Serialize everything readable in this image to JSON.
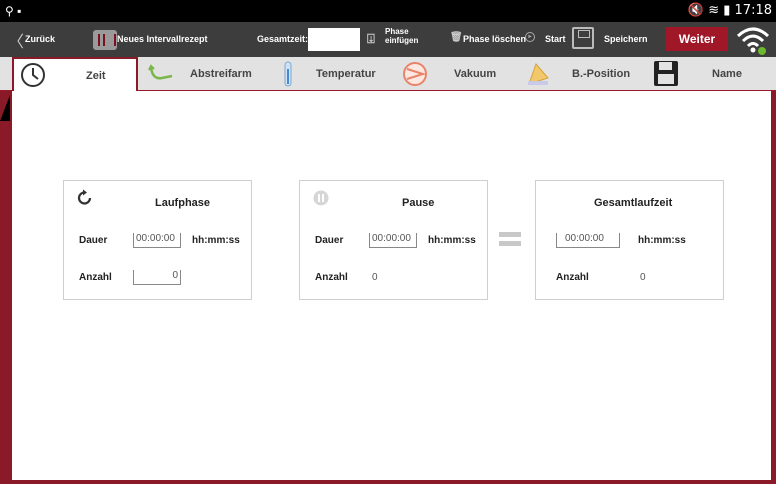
{
  "statusbar": {
    "clock": "17:18",
    "icons_left": "⚲ ▪",
    "icons_right": "🔇 ≋ ▮"
  },
  "actionbar": {
    "back_label": "Zurück",
    "recipe_title": "Neues Intervallrezept",
    "total_label": "Gesamtzeit:",
    "total_value": "",
    "insert_label_1": "Phase",
    "insert_label_2": "einfügen",
    "delete_label": "Phase löschen",
    "start_label": "Start",
    "save_label": "Speichern",
    "next_label": "Weiter"
  },
  "tabs": [
    {
      "label": "Zeit",
      "active": true
    },
    {
      "label": "Abstreifarm"
    },
    {
      "label": "Temperatur"
    },
    {
      "label": "Vakuum"
    },
    {
      "label": "B.-Position"
    },
    {
      "label": "Name"
    }
  ],
  "cards": {
    "run": {
      "title": "Laufphase",
      "duration_label": "Dauer",
      "duration_value": "00:00:00",
      "unit": "hh:mm:ss",
      "count_label": "Anzahl",
      "count_value": "0"
    },
    "pause": {
      "title": "Pause",
      "duration_label": "Dauer",
      "duration_value": "00:00:00",
      "unit": "hh:mm:ss",
      "count_label": "Anzahl",
      "count_value": "0"
    },
    "total": {
      "title": "Gesamtlaufzeit",
      "duration_value": "00:00:00",
      "unit": "hh:mm:ss",
      "count_label": "Anzahl",
      "count_value": "0"
    }
  },
  "colors": {
    "accent": "#8a1a28",
    "button": "#a01828",
    "actionbar": "#3d3d3d",
    "tabbar": "#e2e2e2"
  }
}
